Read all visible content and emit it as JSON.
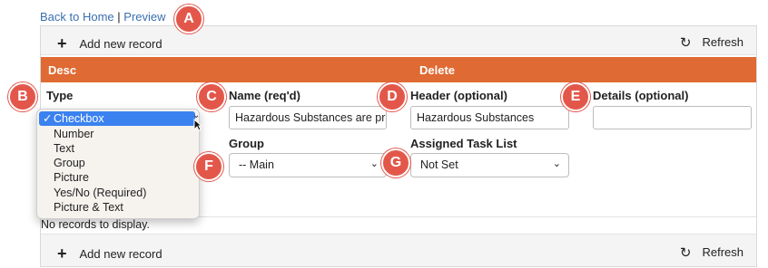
{
  "links": {
    "back": "Back to Home",
    "sep": "|",
    "preview": "Preview"
  },
  "toolbar": {
    "add_label": "Add new record",
    "refresh_label": "Refresh"
  },
  "header": {
    "col1": "Desc",
    "col2": "Delete"
  },
  "form": {
    "type_label": "Type",
    "name_label": "Name (req'd)",
    "name_value": "Hazardous Substances are pre",
    "header_label": "Header (optional)",
    "header_value": "Hazardous Substances",
    "details_label": "Details (optional)",
    "details_value": "",
    "group_label": "Group",
    "group_value": "-- Main",
    "task_label": "Assigned Task List",
    "task_value": "Not Set"
  },
  "dropdown": {
    "options": [
      "Checkbox",
      "Number",
      "Text",
      "Group",
      "Picture",
      "Yes/No (Required)",
      "Picture & Text"
    ],
    "selected": "Checkbox"
  },
  "empty_text": "No records to display.",
  "badges": [
    "A",
    "B",
    "C",
    "D",
    "E",
    "F",
    "G"
  ],
  "colors": {
    "header_bg": "#e06a33",
    "badge": "#e3574b",
    "selected": "#3b82f0",
    "link": "#3a6fb0"
  }
}
